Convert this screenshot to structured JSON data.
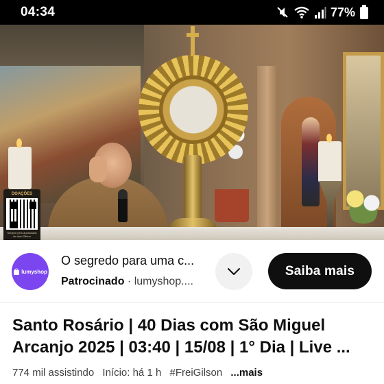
{
  "status_bar": {
    "time": "04:34",
    "battery_percent": "77%",
    "icons": [
      "mute-icon",
      "wifi-icon",
      "signal-icon",
      "battery-icon"
    ]
  },
  "video_overlay": {
    "qr_title": "DOAÇÕES",
    "qr_caption": "Sempre pelo apostolado de dom Gilson"
  },
  "ad": {
    "logo_text": "lumyshop",
    "title": "O segredo para uma c...",
    "sponsored_label": "Patrocinado",
    "separator": "·",
    "domain": "lumyshop....",
    "cta_label": "Saiba mais",
    "accent_color": "#7b45f0"
  },
  "video": {
    "title": "Santo Rosário | 40 Dias com São Miguel Arcanjo 2025 | 03:40 | 15/08 | 1° Dia | Live ...",
    "viewers": "774 mil assistindo",
    "started": "Início: há 1 h",
    "hashtag": "#FreiGilson",
    "more_label": "...mais"
  }
}
